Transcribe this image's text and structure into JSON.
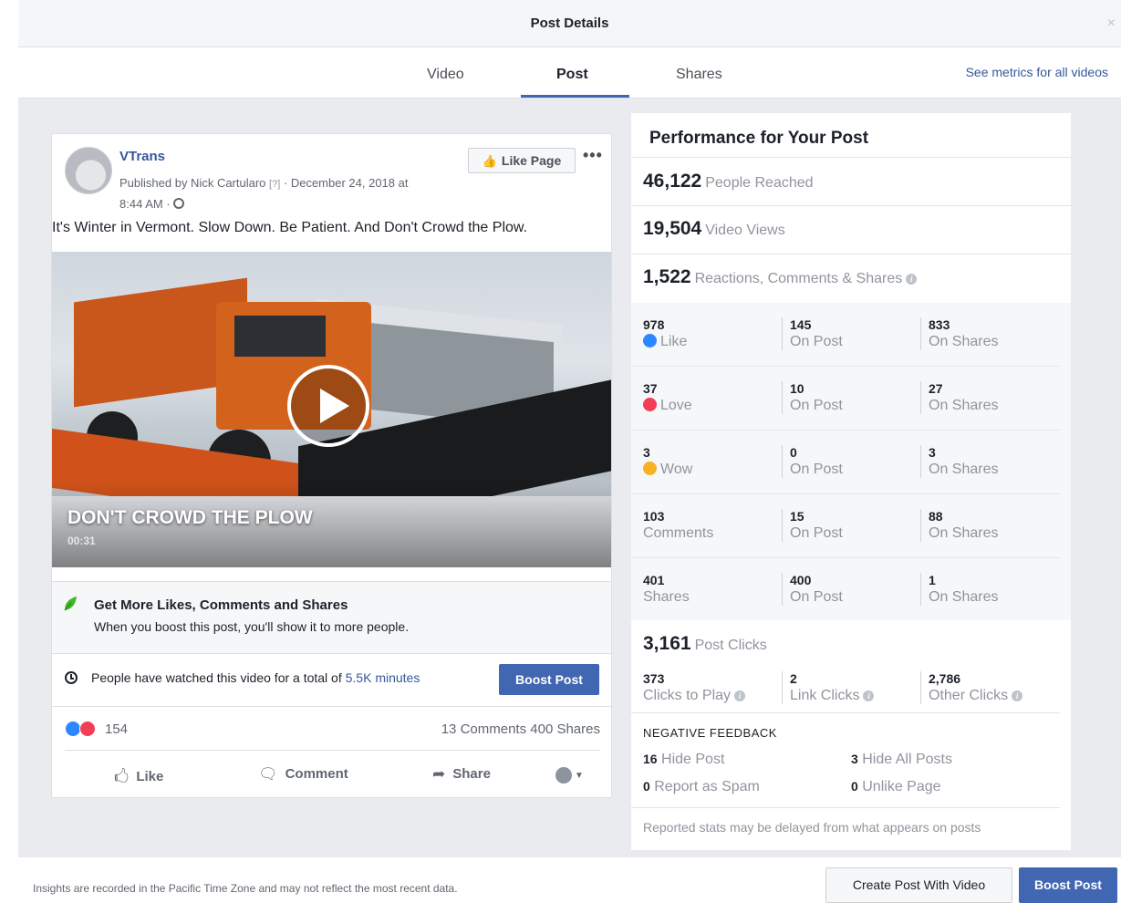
{
  "dialog": {
    "title": "Post Details",
    "close_icon": "×"
  },
  "tabs": [
    {
      "label": "Video"
    },
    {
      "label": "Post"
    },
    {
      "label": "Shares"
    }
  ],
  "see_metrics_link": "See metrics for all videos",
  "post": {
    "page_name": "VTrans",
    "published_by": "Published by Nick Cartularo",
    "published_q": "[?]",
    "published_date": "· December 24, 2018 at",
    "published_time": "8:44 AM ·",
    "like_page_label": "Like Page",
    "more_dots": "•••",
    "caption": "It's Winter in Vermont. Slow Down. Be Patient. And Don't Crowd the Plow.",
    "video_title": "DON'T CROWD THE PLOW",
    "video_duration": "00:31",
    "boost_tip_title": "Get More Likes, Comments and Shares",
    "boost_tip_sub": "When you boost this post, you'll show it to more people.",
    "watch_text": "People have watched this video for a total of",
    "watch_link": "5.5K minutes",
    "boost_post_label": "Boost Post",
    "reaction_count": "154",
    "comments_label": "13 Comments",
    "shares_label": "400 Shares",
    "actions": {
      "like": "Like",
      "comment": "Comment",
      "share": "Share"
    }
  },
  "performance": {
    "title": "Performance for Your Post",
    "people_reached": {
      "value": "46,122",
      "label": "People Reached"
    },
    "video_views": {
      "value": "19,504",
      "label": "Video Views"
    },
    "engagement": {
      "value": "1,522",
      "label": "Reactions, Comments & Shares"
    },
    "rows": [
      {
        "total": "978",
        "total_label": "Like",
        "on_post": "145",
        "on_post_label": "On Post",
        "on_shares": "833",
        "on_shares_label": "On Shares"
      },
      {
        "total": "37",
        "total_label": "Love",
        "on_post": "10",
        "on_post_label": "On Post",
        "on_shares": "27",
        "on_shares_label": "On Shares"
      },
      {
        "total": "3",
        "total_label": "Wow",
        "on_post": "0",
        "on_post_label": "On Post",
        "on_shares": "3",
        "on_shares_label": "On Shares"
      },
      {
        "total": "103",
        "total_label": "Comments",
        "on_post": "15",
        "on_post_label": "On Post",
        "on_shares": "88",
        "on_shares_label": "On Shares"
      },
      {
        "total": "401",
        "total_label": "Shares",
        "on_post": "400",
        "on_post_label": "On Post",
        "on_shares": "1",
        "on_shares_label": "On Shares"
      }
    ],
    "post_clicks": {
      "value": "3,161",
      "label": "Post Clicks"
    },
    "clicks": [
      {
        "value": "373",
        "label": "Clicks to Play"
      },
      {
        "value": "2",
        "label": "Link Clicks"
      },
      {
        "value": "2,786",
        "label": "Other Clicks"
      }
    ],
    "negative_title": "NEGATIVE FEEDBACK",
    "negative": [
      {
        "value": "16",
        "label": "Hide Post"
      },
      {
        "value": "3",
        "label": "Hide All Posts"
      },
      {
        "value": "0",
        "label": "Report as Spam"
      },
      {
        "value": "0",
        "label": "Unlike Page"
      }
    ],
    "disclaimer": "Reported stats may be delayed from what appears on posts"
  },
  "footer": {
    "note": "Insights are recorded in the Pacific Time Zone and may not reflect the most recent data.",
    "create_post_label": "Create Post With Video",
    "boost_post_label": "Boost Post"
  },
  "colors": {
    "accent": "#4267b2",
    "link": "#365899",
    "like": "#2d88ff",
    "love": "#f33e58",
    "wow": "#f7b125"
  }
}
